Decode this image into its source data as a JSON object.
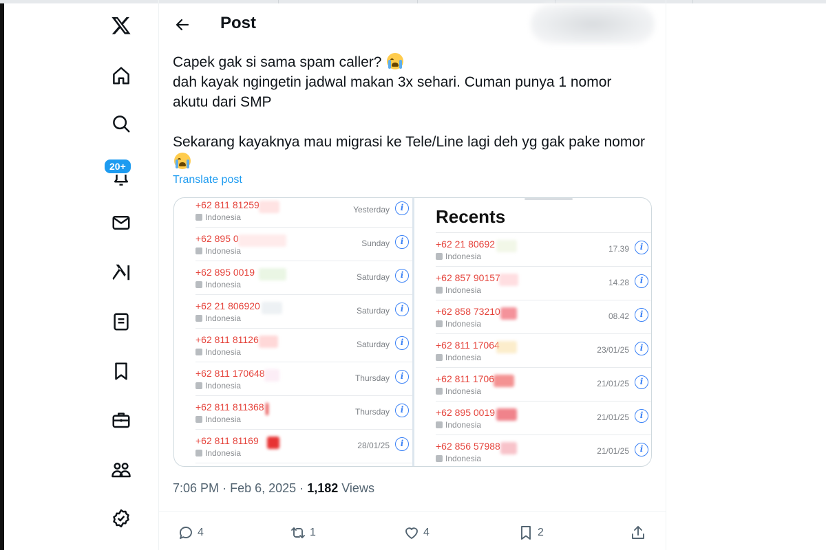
{
  "header": {
    "title": "Post"
  },
  "nav": {
    "notifications_badge": "20+"
  },
  "post": {
    "line1": "Capek gak si sama spam caller?",
    "line2": "dah kayak ngingetin jadwal makan 3x sehari. Cuman punya 1 nomor",
    "line3": "akutu dari SMP",
    "line4": "Sekarang kayaknya mau migrasi ke Tele/Line lagi deh yg gak pake nomor",
    "translate_label": "Translate post",
    "time": "7:06 PM",
    "date": "Feb 6, 2025",
    "views_count": "1,182",
    "views_label": "Views",
    "separator": "·"
  },
  "image": {
    "left_calls": [
      {
        "number": "+62 811 81259",
        "location": "Indonesia",
        "time": "Yesterday"
      },
      {
        "number": "+62 895 0",
        "location": "Indonesia",
        "time": "Sunday"
      },
      {
        "number": "+62 895 0019",
        "location": "Indonesia",
        "time": "Saturday"
      },
      {
        "number": "+62 21 806920",
        "location": "Indonesia",
        "time": "Saturday"
      },
      {
        "number": "+62 811 81126",
        "location": "Indonesia",
        "time": "Saturday"
      },
      {
        "number": "+62 811 170648",
        "location": "Indonesia",
        "time": "Thursday"
      },
      {
        "number": "+62 811 811368",
        "location": "Indonesia",
        "time": "Thursday"
      },
      {
        "number": "+62 811 81169",
        "location": "Indonesia",
        "time": "28/01/25"
      }
    ],
    "recents_title": "Recents",
    "right_calls": [
      {
        "number": "+62 21 80692",
        "location": "Indonesia",
        "time": "17.39"
      },
      {
        "number": "+62 857 90157",
        "location": "Indonesia",
        "time": "14.28"
      },
      {
        "number": "+62 858 73210",
        "location": "Indonesia",
        "time": "08.42"
      },
      {
        "number": "+62 811 17064",
        "location": "Indonesia",
        "time": "23/01/25"
      },
      {
        "number": "+62 811 1706",
        "location": "Indonesia",
        "time": "21/01/25"
      },
      {
        "number": "+62 895 0019",
        "location": "Indonesia",
        "time": "21/01/25"
      },
      {
        "number": "+62 856 57988",
        "location": "Indonesia",
        "time": "21/01/25"
      }
    ]
  },
  "actions": {
    "replies": "4",
    "reposts": "1",
    "likes": "4",
    "bookmarks": "2"
  },
  "colors": {
    "accent": "#1d9bf0",
    "missed_call": "#e5433b",
    "info_icon": "#3b82f6"
  }
}
